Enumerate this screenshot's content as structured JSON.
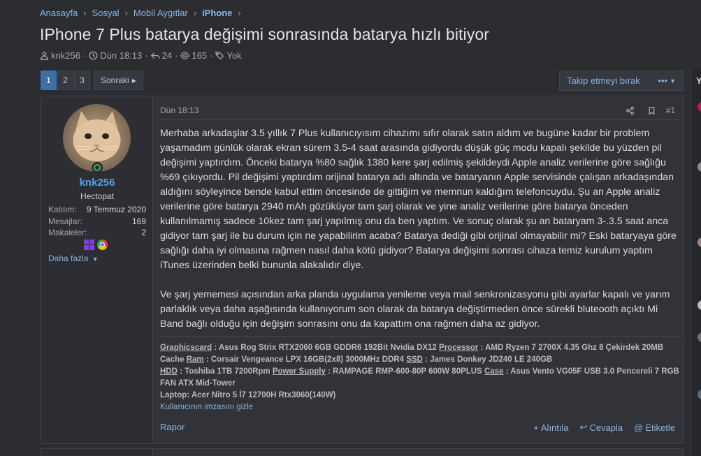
{
  "breadcrumb": {
    "items": [
      "Anasayfa",
      "Sosyal",
      "Mobil Aygıtlar",
      "iPhone"
    ]
  },
  "thread": {
    "title": "IPhone 7 Plus batarya değişimi sonrasında batarya hızlı bitiyor",
    "author": "knk256",
    "date": "Dün 18:13",
    "replies": "24",
    "views": "165",
    "tags": "Yok"
  },
  "pagination": {
    "pages": [
      "1",
      "2",
      "3"
    ],
    "next_label": "Sonraki"
  },
  "watch": {
    "label": "Takip etmeyi bırak",
    "more": "•••"
  },
  "right_rail": {
    "glyph": "Y"
  },
  "post": {
    "date": "Dün 18:13",
    "number": "#1",
    "user": {
      "name": "knk256",
      "title": "Hectopat",
      "stats": [
        {
          "label": "Katılım:",
          "value": "9 Temmuz 2020"
        },
        {
          "label": "Mesajlar:",
          "value": "169"
        },
        {
          "label": "Makaleler:",
          "value": "2"
        }
      ],
      "more_label": "Daha fazla"
    },
    "paragraphs": [
      "Merhaba arkadaşlar 3.5 yıllık 7 Plus kullanıcıyısım cihazımı sıfır olarak satın aldım ve bugüne kadar bir problem yaşamadım günlük olarak ekran sürem 3.5-4 saat arasında gidiyordu düşük güç modu kapalı şekilde bu yüzden pil değişimi yaptırdım. Önceki batarya %80 sağlık 1380 kere şarj edilmiş şekildeydi Apple analiz verilerine göre sağlığu %69 çıkıyordu. Pil değişimi yaptırdım orijinal batarya adı altında ve bataryanın Apple servisinde çalışan arkadaşından aldığını söyleyince bende kabul ettim öncesinde de gittiğim ve memnun kaldığım telefoncuydu. Şu an Apple analiz verilerine göre batarya 2940 mAh gözüküyor tam şarj olarak ve yine analiz verilerine göre batarya önceden kullanılmamış sadece 10kez tam şarj yapılmış onu da ben yaptım. Ve sonuç olarak şu an bataryam 3-.3.5 saat anca gidiyor tam şarj ile bu durum için ne yapabilirim acaba? Batarya dediği gibi orijinal olmayabilir mi? Eski bataryaya göre sağlığı daha iyi olmasına rağmen nasıl daha kötü gidiyor? Batarya değişimi sonrası cihaza temiz kurulum yaptım iTunes üzerinden belki bununla alakalıdır diye.",
      "Ve şarj yememesi açısından arka planda uygulama yenileme veya mail senkronizasyonu gibi ayarlar kapalı ve yarım parlaklık veya daha aşağısında kullanıyorum son olarak da batarya değiştirmeden önce sürekli bluteooth açıktı Mi Band bağlı olduğu için değişim sonrasını onu da kapattım ona rağmen daha az gidiyor."
    ],
    "signature": {
      "gpu_label": "Graphicscard",
      "gpu_value": " : Asus Rog Strix RTX2060 6GB GDDR6 192Bit Nvidia DX12 ",
      "cpu_label": "Processor",
      "cpu_value": " : AMD Ryzen 7 2700X 4.35 Ghz 8 Çekirdek 20MB Cache ",
      "ram_label": "Ram",
      "ram_value": " : Corsair Vengeance LPX 16GB(2x8) 3000MHz DDR4 ",
      "ssd_label": "SSD",
      "ssd_value": " : James Donkey JD240 LE 240GB",
      "hdd_label": "HDD",
      "hdd_value": " : Toshiba 1TB 7200Rpm ",
      "psu_label": "Power Supply",
      "psu_value": " : RAMPAGE RMP-600-80P 600W 80PLUS ",
      "case_label": "Case",
      "case_value": " : Asus Vento VG05F USB 3.0 Pencereli 7 RGB FAN ATX Mid-Tower",
      "laptop": "Laptop: Acer Nitro 5 İ7 12700H Rtx3060(140W)",
      "toggle": "Kullanıcının imzasını gizle"
    },
    "footer": {
      "report": "Rapor",
      "quote": "Alıntıla",
      "reply": "Cevapla",
      "mention": "Etiketle"
    }
  },
  "colors": {
    "background": "#2b2d31",
    "panel": "#313338",
    "link": "#8ab4e0",
    "username": "#5b9ee6",
    "active_page": "#3d6fa8",
    "online": "#4caf50"
  }
}
